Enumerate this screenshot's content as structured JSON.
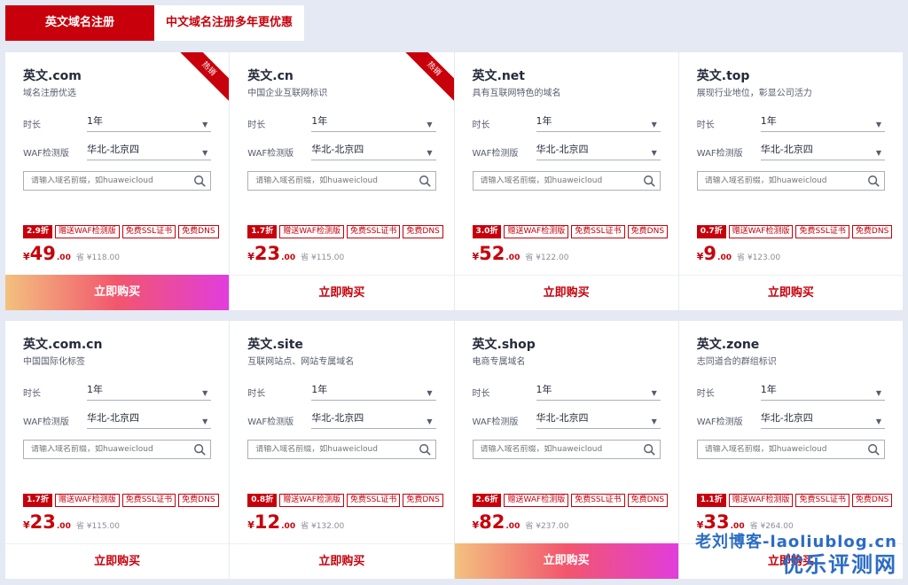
{
  "tabs": [
    {
      "label": "英文域名注册",
      "active": true
    },
    {
      "label": "中文域名注册多年更优惠",
      "active": false
    }
  ],
  "common": {
    "duration_label": "时长",
    "duration_value": "1年",
    "waf_label": "WAF检测版",
    "waf_value": "华北-北京四",
    "search_placeholder": "请输入域名前缀，如huaweicloud",
    "tag_waf": "赠送WAF检测版",
    "tag_ssl": "免费SSL证书",
    "tag_dns": "免费DNS",
    "currency": "¥",
    "decimal": ".00",
    "orig_prefix": "省 ¥",
    "buy_label": "立即购买",
    "hot_label": "热销"
  },
  "cards": [
    {
      "name": "英文.com",
      "desc": "域名注册优选",
      "discount": "2.9折",
      "price": "49",
      "orig": "118.00",
      "hot": true,
      "highlight": true
    },
    {
      "name": "英文.cn",
      "desc": "中国企业互联网标识",
      "discount": "1.7折",
      "price": "23",
      "orig": "115.00",
      "hot": true,
      "highlight": false
    },
    {
      "name": "英文.net",
      "desc": "具有互联网特色的域名",
      "discount": "3.0折",
      "price": "52",
      "orig": "122.00",
      "hot": false,
      "highlight": false
    },
    {
      "name": "英文.top",
      "desc": "展现行业地位，彰显公司活力",
      "discount": "0.7折",
      "price": "9",
      "orig": "123.00",
      "hot": false,
      "highlight": false
    },
    {
      "name": "英文.com.cn",
      "desc": "中国国际化标签",
      "discount": "1.7折",
      "price": "23",
      "orig": "115.00",
      "hot": false,
      "highlight": false
    },
    {
      "name": "英文.site",
      "desc": "互联网站点、网站专属域名",
      "discount": "0.8折",
      "price": "12",
      "orig": "132.00",
      "hot": false,
      "highlight": false
    },
    {
      "name": "英文.shop",
      "desc": "电商专属域名",
      "discount": "2.6折",
      "price": "82",
      "orig": "237.00",
      "hot": false,
      "highlight": true
    },
    {
      "name": "英文.zone",
      "desc": "志同道合的群组标识",
      "discount": "1.1折",
      "price": "33",
      "orig": "264.00",
      "hot": false,
      "highlight": false
    }
  ],
  "watermark": {
    "line1": "老刘博客-laoliublog.cn",
    "line2": "优乐评测网"
  }
}
